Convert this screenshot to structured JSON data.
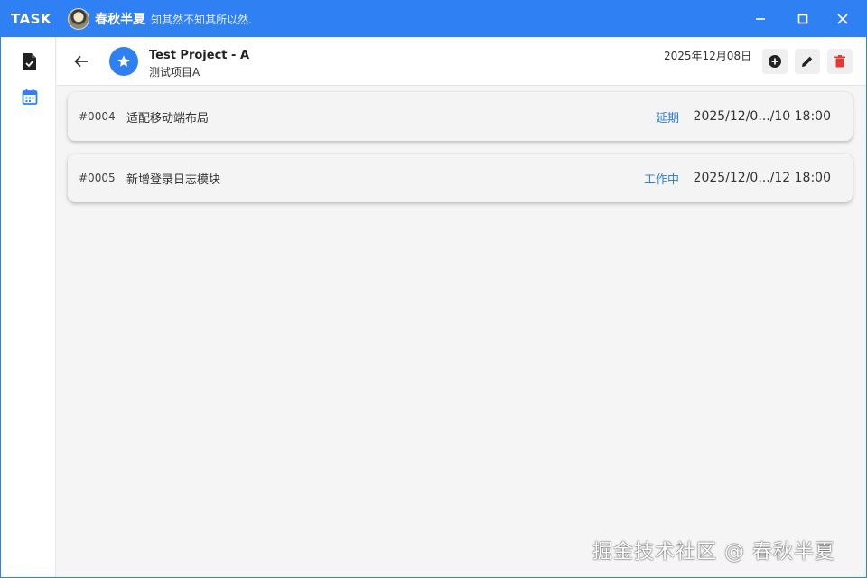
{
  "titlebar": {
    "app_name": "TASK",
    "user_name": "春秋半夏",
    "motto": "知其然不知其所以然."
  },
  "window_controls": {
    "minimize_icon": "minimize-icon",
    "maximize_icon": "maximize-icon",
    "close_icon": "close-icon"
  },
  "sidebar": {
    "items": [
      {
        "icon": "task-check-icon",
        "active": false
      },
      {
        "icon": "calendar-icon",
        "active": true
      }
    ]
  },
  "header": {
    "project_title": "Test Project - A",
    "project_subtitle": "测试项目A",
    "date": "2025年12月08日",
    "actions": [
      "add-icon",
      "edit-icon",
      "delete-icon"
    ]
  },
  "tasks": [
    {
      "id": "#0004",
      "name": "适配移动端布局",
      "status": "延期",
      "date": "2025/12/0.../10 18:00"
    },
    {
      "id": "#0005",
      "name": "新增登录日志模块",
      "status": "工作中",
      "date": "2025/12/0.../12 18:00"
    }
  ],
  "watermark": "掘金技术社区 @ 春秋半夏",
  "colors": {
    "accent": "#2f80f2",
    "status": "#2f7fd6",
    "delete": "#e53935"
  }
}
